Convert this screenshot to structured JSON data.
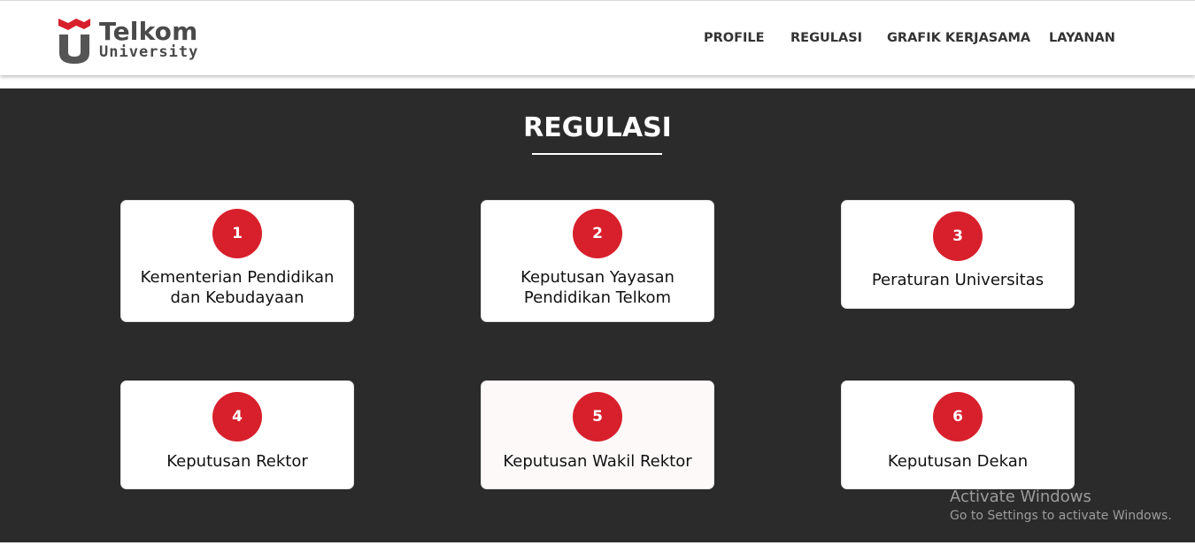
{
  "brand": {
    "name": "Telkom",
    "tagline": "University",
    "colors": {
      "red": "#d7202c",
      "gray": "#4a4a4a"
    }
  },
  "nav": {
    "items": [
      {
        "label": "PROFILE"
      },
      {
        "label": "REGULASI"
      },
      {
        "label": "GRAFIK KERJASAMA"
      },
      {
        "label": "LAYANAN"
      }
    ]
  },
  "main": {
    "title": "REGULASI",
    "background": "#2b2b2b",
    "cards": [
      {
        "number": "1",
        "label_lines": [
          "Kementerian Pendidikan",
          "dan Kebudayaan"
        ]
      },
      {
        "number": "2",
        "label_lines": [
          "Keputusan Yayasan",
          "Pendidikan Telkom"
        ]
      },
      {
        "number": "3",
        "label_lines": [
          "Peraturan Universitas"
        ]
      },
      {
        "number": "4",
        "label_lines": [
          "Keputusan Rektor"
        ]
      },
      {
        "number": "5",
        "label_lines": [
          "Keputusan Wakil Rektor"
        ]
      },
      {
        "number": "6",
        "label_lines": [
          "Keputusan Dekan"
        ]
      }
    ]
  },
  "watermark": {
    "title": "Activate Windows",
    "subtitle": "Go to Settings to activate Windows."
  }
}
